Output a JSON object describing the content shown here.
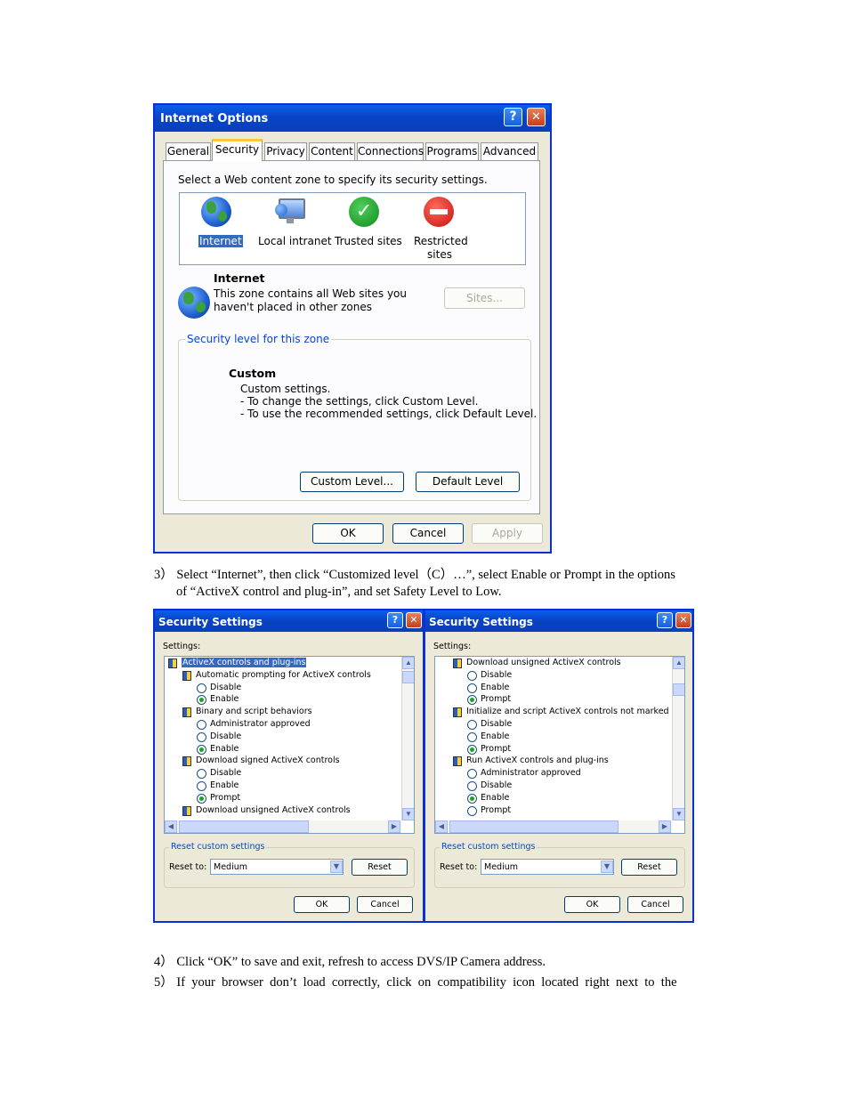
{
  "internet_options": {
    "title": "Internet Options",
    "help_glyph": "?",
    "close_glyph": "✕",
    "tabs": [
      "General",
      "Security",
      "Privacy",
      "Content",
      "Connections",
      "Programs",
      "Advanced"
    ],
    "zone_prompt": "Select a Web content zone to specify its security settings.",
    "zones": [
      {
        "label": "Internet",
        "icon": "globe-icon"
      },
      {
        "label": "Local intranet",
        "icon": "intranet-monitor-icon"
      },
      {
        "label": "Trusted sites",
        "icon": "checkmark-icon"
      },
      {
        "label": "Restricted sites",
        "icon": "no-entry-icon"
      }
    ],
    "zone_heading": "Internet",
    "zone_desc_line1": "This zone contains all Web sites you",
    "zone_desc_line2": "haven't placed in other zones",
    "sites_button": "Sites...",
    "security_level_title": "Security level for this zone",
    "level_name": "Custom",
    "level_lines": [
      "Custom settings.",
      "- To change the settings, click Custom Level.",
      "- To use the recommended settings, click Default Level."
    ],
    "custom_level_button": "Custom Level...",
    "default_level_button": "Default Level",
    "ok_button": "OK",
    "cancel_button": "Cancel",
    "apply_button": "Apply"
  },
  "step3_line1": "3） Select “Internet”, then click “Customized level（C）…”, select Enable or Prompt in the options",
  "step3_line2": "of “ActiveX control and plug-in”, and set Safety Level to Low.",
  "security_settings_left": {
    "title": "Security Settings",
    "settings_label": "Settings:",
    "items": [
      {
        "type": "cat",
        "text": "ActiveX controls and plug-ins",
        "selected": true
      },
      {
        "type": "group",
        "text": "Automatic prompting for ActiveX controls"
      },
      {
        "type": "radio",
        "text": "Disable",
        "on": false
      },
      {
        "type": "radio",
        "text": "Enable",
        "on": true
      },
      {
        "type": "group",
        "text": "Binary and script behaviors"
      },
      {
        "type": "radio",
        "text": "Administrator approved",
        "on": false
      },
      {
        "type": "radio",
        "text": "Disable",
        "on": false
      },
      {
        "type": "radio",
        "text": "Enable",
        "on": true
      },
      {
        "type": "group",
        "text": "Download signed ActiveX controls"
      },
      {
        "type": "radio",
        "text": "Disable",
        "on": false
      },
      {
        "type": "radio",
        "text": "Enable",
        "on": false
      },
      {
        "type": "radio",
        "text": "Prompt",
        "on": true
      },
      {
        "type": "group",
        "text": "Download unsigned ActiveX controls"
      }
    ],
    "reset_group_title": "Reset custom settings",
    "reset_to_label": "Reset to:",
    "reset_value": "Medium",
    "reset_button": "Reset",
    "ok_button": "OK",
    "cancel_button": "Cancel"
  },
  "security_settings_right": {
    "title": "Security Settings",
    "settings_label": "Settings:",
    "items": [
      {
        "type": "group",
        "text": "Download unsigned ActiveX controls"
      },
      {
        "type": "radio",
        "text": "Disable",
        "on": false
      },
      {
        "type": "radio",
        "text": "Enable",
        "on": false
      },
      {
        "type": "radio",
        "text": "Prompt",
        "on": true
      },
      {
        "type": "group",
        "text": "Initialize and script ActiveX controls not marked as safe"
      },
      {
        "type": "radio",
        "text": "Disable",
        "on": false
      },
      {
        "type": "radio",
        "text": "Enable",
        "on": false
      },
      {
        "type": "radio",
        "text": "Prompt",
        "on": true
      },
      {
        "type": "group",
        "text": "Run ActiveX controls and plug-ins"
      },
      {
        "type": "radio",
        "text": "Administrator approved",
        "on": false
      },
      {
        "type": "radio",
        "text": "Disable",
        "on": false
      },
      {
        "type": "radio",
        "text": "Enable",
        "on": true
      },
      {
        "type": "radio",
        "text": "Prompt",
        "on": false
      }
    ],
    "reset_group_title": "Reset custom settings",
    "reset_to_label": "Reset to:",
    "reset_value": "Medium",
    "reset_button": "Reset",
    "ok_button": "OK",
    "cancel_button": "Cancel"
  },
  "step4": "4） Click “OK” to save and exit, refresh to access DVS/IP Camera address.",
  "step5": "5） If  your  browser  don’t  load  correctly,  click  on  compatibility  icon  located  right  next  to  the"
}
